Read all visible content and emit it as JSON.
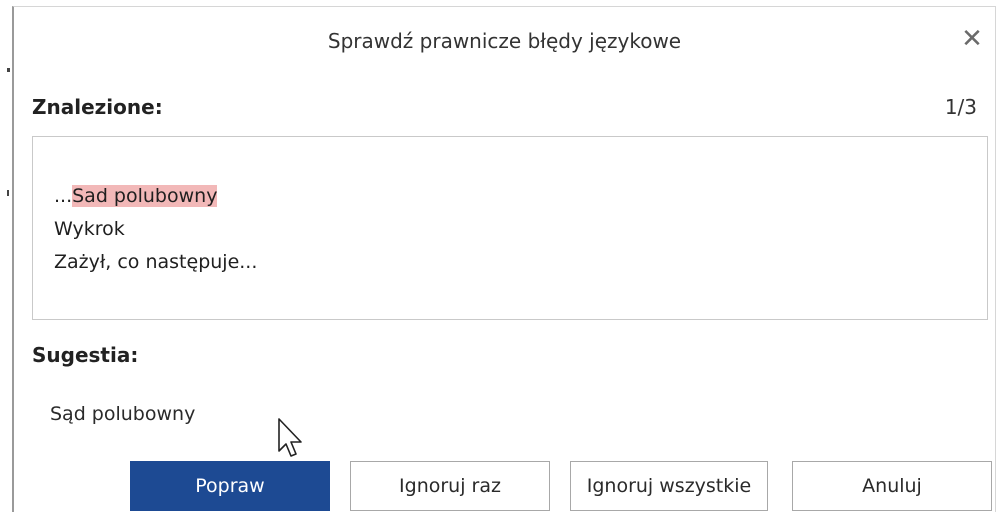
{
  "dialog": {
    "title": "Sprawdź prawnicze błędy językowe",
    "close_icon": "close-icon"
  },
  "found": {
    "label": "Znalezione:",
    "counter": "1/3",
    "prefix": "...",
    "highlight": "Sad polubowny",
    "line2": "Wykrok",
    "line3": "Zażył, co następuje..."
  },
  "suggestion": {
    "label": "Sugestia:",
    "value": "Sąd polubowny"
  },
  "buttons": {
    "fix": "Popraw",
    "ignore_once": "Ignoruj raz",
    "ignore_all": "Ignoruj wszystkie",
    "cancel": "Anuluj"
  },
  "colors": {
    "primary": "#1d4a93",
    "highlight": "#f2b8b8"
  }
}
